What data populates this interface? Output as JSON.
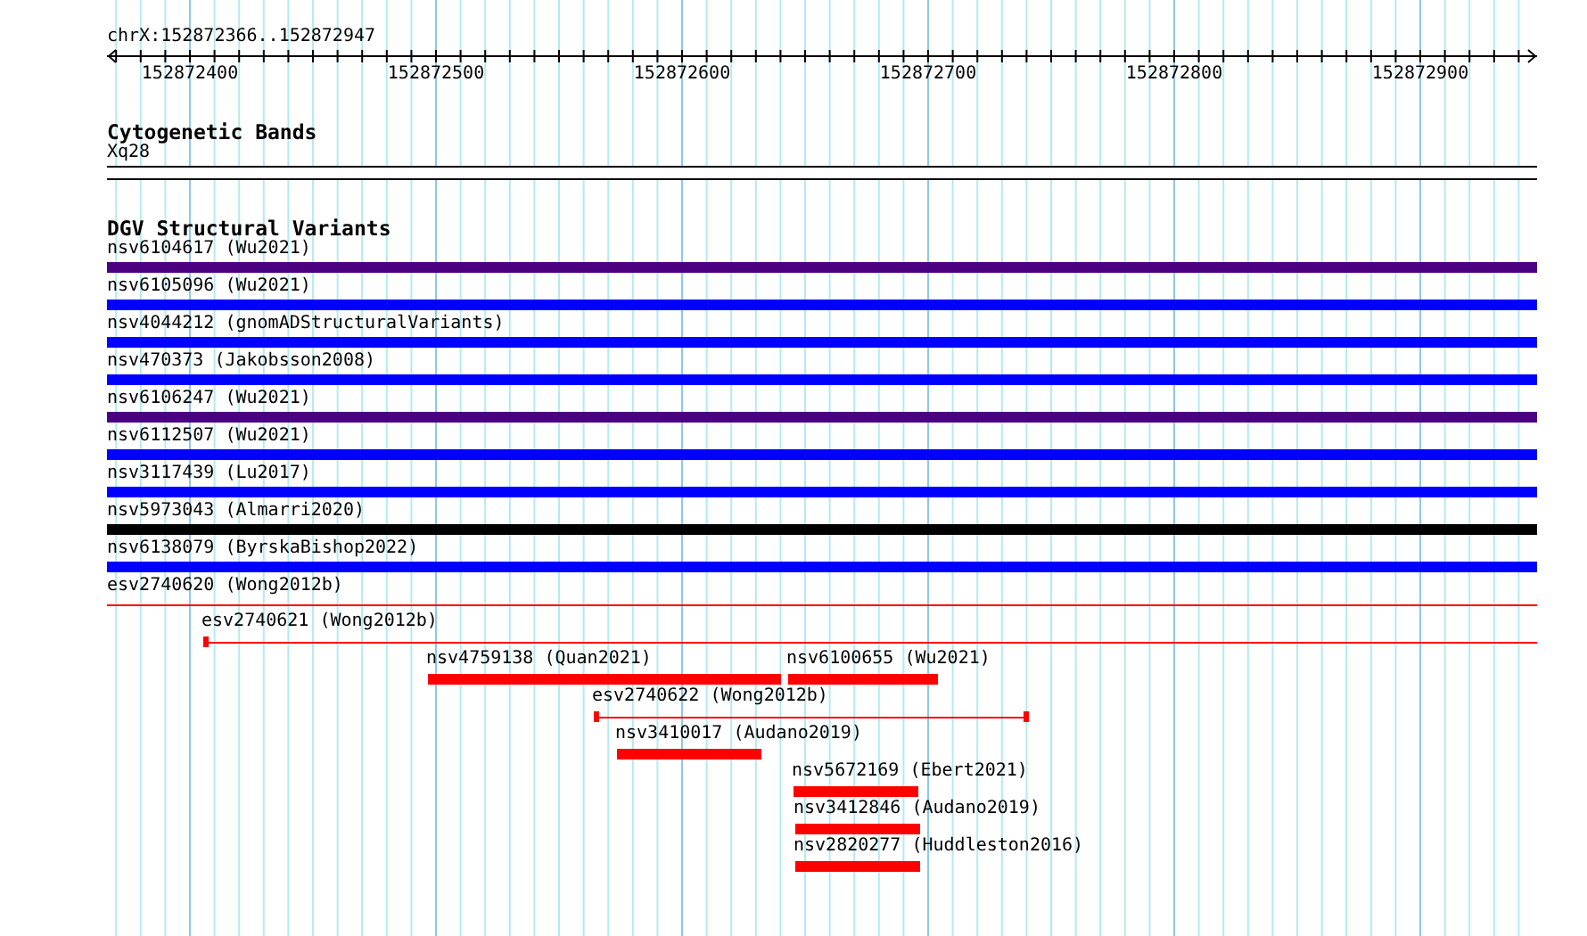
{
  "ruler": {
    "location": "chrX:152872366..152872947",
    "ticks": [
      "152872400",
      "152872500",
      "152872600",
      "152872700",
      "152872800",
      "152872900"
    ]
  },
  "tracks": [
    {
      "title": "Cytogenetic Bands",
      "features": [
        {
          "label": "Xq28",
          "kind": "band"
        }
      ]
    },
    {
      "title": "DGV Structural Variants",
      "features": [
        {
          "label": "nsv6104617 (Wu2021)",
          "kind": "bar",
          "color": "#4b0082"
        },
        {
          "label": "nsv6105096 (Wu2021)",
          "kind": "bar",
          "color": "#0000ff"
        },
        {
          "label": "nsv4044212 (gnomADStructuralVariants)",
          "kind": "bar",
          "color": "#0000ff"
        },
        {
          "label": "nsv470373 (Jakobsson2008)",
          "kind": "bar",
          "color": "#0000ff"
        },
        {
          "label": "nsv6106247 (Wu2021)",
          "kind": "bar",
          "color": "#4b0082"
        },
        {
          "label": "nsv6112507 (Wu2021)",
          "kind": "bar",
          "color": "#0000ff"
        },
        {
          "label": "nsv3117439 (Lu2017)",
          "kind": "bar",
          "color": "#0000ff"
        },
        {
          "label": "nsv5973043 (Almarri2020)",
          "kind": "bar",
          "color": "#000000"
        },
        {
          "label": "nsv6138079 (ByrskaBishop2022)",
          "kind": "bar",
          "color": "#0000ff"
        },
        {
          "label": "esv2740620 (Wong2012b)",
          "kind": "line",
          "color": "#ff0000"
        },
        {
          "label": "esv2740621 (Wong2012b)",
          "kind": "line",
          "color": "#ff0000"
        },
        {
          "label": "nsv4759138 (Quan2021)",
          "kind": "bar",
          "color": "#ff0000"
        },
        {
          "label": "nsv6100655 (Wu2021)",
          "kind": "bar",
          "color": "#ff0000"
        },
        {
          "label": "esv2740622 (Wong2012b)",
          "kind": "line",
          "color": "#ff0000"
        },
        {
          "label": "nsv3410017 (Audano2019)",
          "kind": "bar",
          "color": "#ff0000"
        },
        {
          "label": "nsv5672169 (Ebert2021)",
          "kind": "bar",
          "color": "#ff0000"
        },
        {
          "label": "nsv3412846 (Audano2019)",
          "kind": "bar",
          "color": "#ff0000"
        },
        {
          "label": "nsv2820277 (Huddleston2016)",
          "kind": "bar",
          "color": "#ff0000"
        }
      ]
    }
  ]
}
